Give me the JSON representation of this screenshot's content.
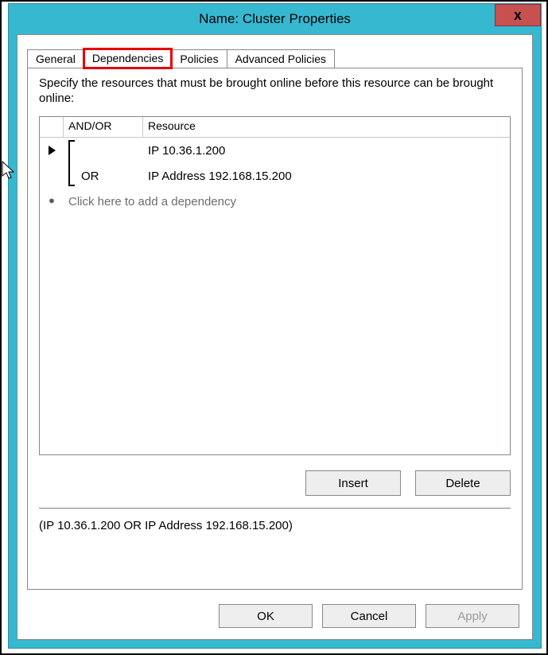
{
  "window": {
    "title": "Name: Cluster Properties",
    "close_glyph": "x"
  },
  "tabs": {
    "general": "General",
    "dependencies": "Dependencies",
    "policies": "Policies",
    "advanced_policies": "Advanced Policies"
  },
  "panel": {
    "instruction": "Specify the resources that must be brought online before this resource can be brought online:",
    "columns": {
      "andor": "AND/OR",
      "resource": "Resource"
    },
    "rows": [
      {
        "indicator": "current",
        "andor": "",
        "resource": "IP 10.36.1.200"
      },
      {
        "indicator": "",
        "andor": "OR",
        "resource": "IP Address 192.168.15.200"
      }
    ],
    "placeholder": "Click here to add a dependency",
    "insert_label": "Insert",
    "delete_label": "Delete",
    "summary": "(IP 10.36.1.200  OR IP Address 192.168.15.200)"
  },
  "buttons": {
    "ok": "OK",
    "cancel": "Cancel",
    "apply": "Apply"
  }
}
